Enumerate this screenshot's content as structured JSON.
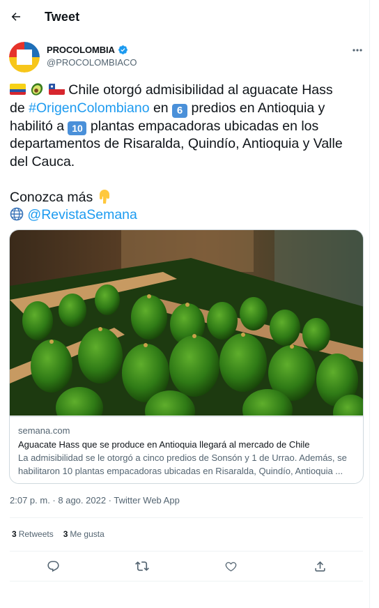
{
  "header": {
    "title": "Tweet"
  },
  "author": {
    "name": "PROCOLOMBIA",
    "handle": "@PROCOLOMBIACO",
    "verified": true
  },
  "tweet": {
    "seg_line1": "Chile otorgó admisibilidad al aguacate Hass",
    "seg_de": "de ",
    "hashtag": "#OrigenColombiano",
    "seg_en": " en ",
    "num1": "6",
    "seg_predios": " predios en Antioquia y",
    "seg_habilito": "habilitó a ",
    "num2": "10",
    "seg_plantas": " plantas empacadoras ubicadas en los",
    "line_departamentos": "departamentos de Risaralda, Quindío, Antioquia y Valle",
    "line_cauca": "del Cauca.",
    "conozca": "Conozca más ",
    "mention": "@RevistaSemana"
  },
  "card": {
    "domain": "semana.com",
    "title": "Aguacate Hass que se produce en Antioquia llegará al mercado de Chile",
    "desc_line1": "La admisibilidad se le otorgó a cinco predios de Sonsón y 1 de Urrao. Además, se",
    "desc_line2": "habilitaron 10 plantas empacadoras ubicadas en Risaralda, Quindío, Antioquia ..."
  },
  "meta": {
    "time": "2:07 p. m.",
    "sep": " · ",
    "date": "8 ago. 2022",
    "source": "Twitter Web App"
  },
  "stats": {
    "retweets_count": "3",
    "retweets_label": "Retweets",
    "likes_count": "3",
    "likes_label": "Me gusta"
  },
  "icons": {
    "back": "arrow-left-icon",
    "more": "more-horizontal-icon",
    "verified": "verified-badge-icon",
    "reply": "reply-icon",
    "retweet": "retweet-icon",
    "like": "heart-icon",
    "share": "share-icon",
    "globe": "globe-icon",
    "point-down": "pointing-down-hand-icon",
    "avocado": "avocado-icon"
  },
  "colors": {
    "accent": "#1d9bf0",
    "text": "#0f1419",
    "secondary": "#536471",
    "border": "#cfd9de"
  }
}
